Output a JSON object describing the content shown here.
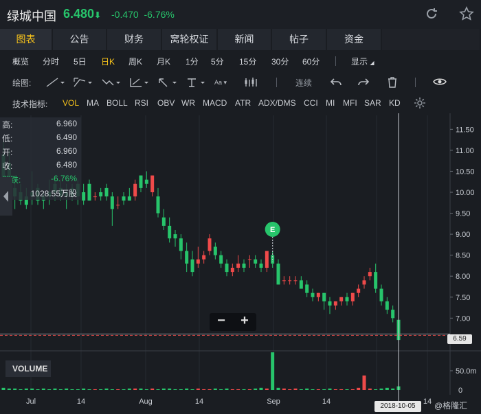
{
  "header": {
    "name": "绿城中国",
    "price": "6.480",
    "price_arrow": "⬇",
    "change": "-0.470",
    "change_pct": "-6.76%"
  },
  "tabs": [
    {
      "label": "图表"
    },
    {
      "label": "公告"
    },
    {
      "label": "财务"
    },
    {
      "label": "窝轮权证"
    },
    {
      "label": "新闻"
    },
    {
      "label": "帖子"
    },
    {
      "label": "资金"
    }
  ],
  "periods": [
    "概览",
    "分时",
    "5日",
    "日K",
    "周K",
    "月K",
    "1分",
    "5分",
    "15分",
    "30分",
    "60分"
  ],
  "display_label": "显示",
  "draw_label": "绘图:",
  "continuous_label": "连续",
  "indicator_label": "技术指标:",
  "indicators": [
    "VOL",
    "MA",
    "BOLL",
    "RSI",
    "OBV",
    "WR",
    "MACD",
    "ATR",
    "ADX/DMS",
    "CCI",
    "MI",
    "MFI",
    "SAR",
    "KD"
  ],
  "info": {
    "high_label": "高:",
    "high": "6.960",
    "low_label": "低:",
    "low": "6.490",
    "open_label": "开:",
    "open": "6.960",
    "close_label": "收:",
    "close": "6.480",
    "chg_label": "涨跌:",
    "chg": "-6.76%",
    "vol_label": "量:",
    "vol": "1028.55万股"
  },
  "event_marker": "E",
  "volume_label": "VOLUME",
  "date_tip": "2018-10-05",
  "price_tip": "6.59",
  "watermark": "@格隆汇",
  "colors": {
    "up": "#ef4a4a",
    "down": "#27c46b",
    "accent": "#f6c21b"
  },
  "chart_data": {
    "type": "candlestick",
    "y_ticks": [
      "11.50",
      "11.00",
      "10.50",
      "10.00",
      "9.50",
      "9.00",
      "8.50",
      "8.00",
      "7.50",
      "7.00"
    ],
    "x_ticks": [
      "Jul",
      "14",
      "Aug",
      "14",
      "Sep",
      "14",
      "14"
    ],
    "volume_ticks": [
      "50.0m",
      "0"
    ],
    "ylim": [
      6.4,
      11.8
    ],
    "candles": [
      [
        10.9,
        11.2,
        10.3,
        10.1
      ],
      [
        10.7,
        11.0,
        10.0,
        9.8
      ],
      [
        10.1,
        10.3,
        9.9,
        9.6
      ],
      [
        10.0,
        10.2,
        9.8,
        9.7
      ],
      [
        9.9,
        10.1,
        9.7,
        9.6
      ],
      [
        10.0,
        10.5,
        9.9,
        9.7
      ],
      [
        10.1,
        10.2,
        9.8,
        9.7
      ],
      [
        9.9,
        10.0,
        9.8,
        9.6
      ],
      [
        10.0,
        10.3,
        9.9,
        9.7
      ],
      [
        10.2,
        10.4,
        10.0,
        9.8
      ],
      [
        10.1,
        10.3,
        9.9,
        9.8
      ],
      [
        10.0,
        10.2,
        9.9,
        9.6
      ],
      [
        10.1,
        10.2,
        9.9,
        9.8
      ],
      [
        10.2,
        10.3,
        9.9,
        9.7
      ],
      [
        10.0,
        10.2,
        9.8,
        9.7
      ],
      [
        10.2,
        10.3,
        9.8,
        9.8
      ],
      [
        9.9,
        10.0,
        9.9,
        9.8
      ],
      [
        10.0,
        10.1,
        9.9,
        9.8
      ],
      [
        10.1,
        10.2,
        9.9,
        9.8
      ],
      [
        9.9,
        10.0,
        9.6,
        9.2
      ],
      [
        9.7,
        9.9,
        9.7,
        9.6
      ],
      [
        9.9,
        10.0,
        9.8,
        9.7
      ],
      [
        9.9,
        10.1,
        9.8,
        9.8
      ],
      [
        9.9,
        10.3,
        10.2,
        9.8
      ],
      [
        10.4,
        10.4,
        10.1,
        10.0
      ],
      [
        10.3,
        10.5,
        10.2,
        10.1
      ],
      [
        10.0,
        10.4,
        10.4,
        9.9
      ],
      [
        9.9,
        10.1,
        9.5,
        9.4
      ],
      [
        9.4,
        9.6,
        9.2,
        9.1
      ],
      [
        9.2,
        9.4,
        8.9,
        8.8
      ],
      [
        9.0,
        9.1,
        8.9,
        8.7
      ],
      [
        8.9,
        9.0,
        8.6,
        8.4
      ],
      [
        8.6,
        8.8,
        8.3,
        8.1
      ],
      [
        8.4,
        8.6,
        8.1,
        8.0
      ],
      [
        8.3,
        8.7,
        8.4,
        8.2
      ],
      [
        8.4,
        8.6,
        8.5,
        8.3
      ],
      [
        8.6,
        9.0,
        8.9,
        8.5
      ],
      [
        8.7,
        8.8,
        8.5,
        8.4
      ],
      [
        8.5,
        8.6,
        8.3,
        8.2
      ],
      [
        8.3,
        8.4,
        8.1,
        8.0
      ],
      [
        8.1,
        8.3,
        8.2,
        8.0
      ],
      [
        8.2,
        8.5,
        8.3,
        8.1
      ],
      [
        8.3,
        8.4,
        8.2,
        8.1
      ],
      [
        8.4,
        8.5,
        8.4,
        8.2
      ],
      [
        8.4,
        8.5,
        8.3,
        8.2
      ],
      [
        8.3,
        8.4,
        8.2,
        8.1
      ],
      [
        8.2,
        8.6,
        8.6,
        8.1
      ],
      [
        8.5,
        8.6,
        8.3,
        8.2
      ],
      [
        8.3,
        8.4,
        7.8,
        7.8
      ],
      [
        7.9,
        8.0,
        7.9,
        7.8
      ],
      [
        7.9,
        8.0,
        7.9,
        7.8
      ],
      [
        7.9,
        8.0,
        7.9,
        7.8
      ],
      [
        7.9,
        8.0,
        7.7,
        7.7
      ],
      [
        7.8,
        7.9,
        7.6,
        7.5
      ],
      [
        7.6,
        7.7,
        7.5,
        7.4
      ],
      [
        7.5,
        7.6,
        7.6,
        7.4
      ],
      [
        7.6,
        7.6,
        7.4,
        7.2
      ],
      [
        7.4,
        7.5,
        7.3,
        7.1
      ],
      [
        7.3,
        7.4,
        7.4,
        7.2
      ],
      [
        7.4,
        7.5,
        7.5,
        7.3
      ],
      [
        7.5,
        7.6,
        7.4,
        7.3
      ],
      [
        7.4,
        7.6,
        7.6,
        7.3
      ],
      [
        7.6,
        7.8,
        7.7,
        7.5
      ],
      [
        7.8,
        8.0,
        7.9,
        7.7
      ],
      [
        8.0,
        8.2,
        8.1,
        7.9
      ],
      [
        8.1,
        8.3,
        7.7,
        7.6
      ],
      [
        7.7,
        7.8,
        7.4,
        7.3
      ],
      [
        7.4,
        7.5,
        7.2,
        7.1
      ],
      [
        7.2,
        7.3,
        7.0,
        6.9
      ],
      [
        6.96,
        6.96,
        6.48,
        6.49
      ]
    ],
    "volumes": [
      3,
      2,
      2,
      1,
      2,
      2,
      1,
      2,
      1,
      2,
      1,
      2,
      1,
      1,
      2,
      1,
      1,
      1,
      2,
      1,
      1,
      1,
      2,
      2,
      2,
      1,
      2,
      1,
      2,
      2,
      1,
      1,
      2,
      1,
      2,
      1,
      1,
      2,
      1,
      2,
      1,
      1,
      1,
      1,
      2,
      3,
      2,
      52,
      3,
      2,
      1,
      2,
      1,
      2,
      1,
      1,
      1,
      2,
      1,
      1,
      1,
      1,
      3,
      20,
      2,
      1,
      2,
      3,
      2,
      5
    ]
  }
}
